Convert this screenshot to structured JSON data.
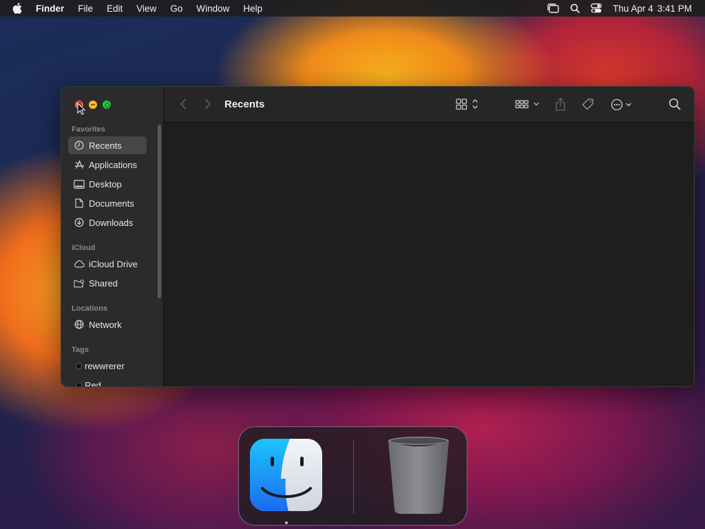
{
  "menubar": {
    "app_name": "Finder",
    "items": [
      "File",
      "Edit",
      "View",
      "Go",
      "Window",
      "Help"
    ],
    "date": "Thu Apr 4",
    "time": "3:41 PM"
  },
  "window": {
    "title": "Recents",
    "sidebar": {
      "sections": {
        "favorites": "Favorites",
        "icloud": "iCloud",
        "locations": "Locations",
        "tags": "Tags"
      },
      "favorites": [
        "Recents",
        "Applications",
        "Desktop",
        "Documents",
        "Downloads"
      ],
      "icloud": [
        "iCloud Drive",
        "Shared"
      ],
      "locations": [
        "Network"
      ],
      "tags": [
        "rewwrerer",
        "Red"
      ]
    }
  },
  "colors": {
    "close": "#ff5f57",
    "minimize": "#febc2e",
    "maximize": "#28c840",
    "sidebar_bg": "#2b2b2d",
    "content_bg": "#1e1e1e"
  },
  "dock": {
    "apps": [
      "finder-icon",
      "trash-icon"
    ]
  }
}
